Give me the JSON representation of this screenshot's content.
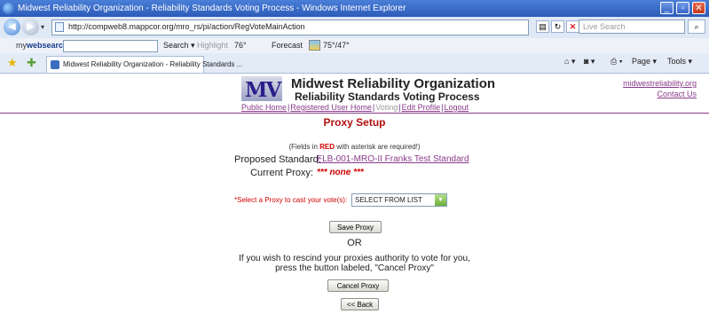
{
  "window": {
    "title": "Midwest Reliability Organization - Reliability Standards Voting Process - Windows Internet Explorer"
  },
  "addressbar": {
    "url": "http://compweb8.mappcor.org/mro_rs/pi/action/RegVoteMainAction",
    "search_placeholder": "Live Search"
  },
  "searchbar": {
    "brand_prefix": "my",
    "brand_name": "websearch",
    "search_label": "Search ▾",
    "highlight_label": "Highlight",
    "weather": "76°",
    "forecast_label": "Forecast",
    "forecast_temps": "75°/47°"
  },
  "tabbar": {
    "tab_title": "Midwest Reliability Organization - Reliability Standards ...",
    "page_menu": "Page ▾",
    "tools_menu": "Tools ▾"
  },
  "header": {
    "org_name": "Midwest Reliability Organization",
    "subtitle": "Reliability Standards Voting Process",
    "nav": {
      "public_home": "Public Home",
      "registered_user_home": "Registered User Home",
      "voting": "Voting",
      "edit_profile": "Edit Profile",
      "logout": "Logout"
    },
    "side_links": {
      "site": "midwestreliability.org",
      "contact": "Contact Us"
    }
  },
  "main": {
    "title": "Proxy Setup",
    "req_note_prefix": "(Fields in",
    "req_note_red": "RED",
    "req_note_suffix": "with asterisk are required!)",
    "proposed_standard_label": "Proposed Standard:",
    "proposed_standard_value": "FLB-001-MRO-II Franks Test Standard",
    "current_proxy_label": "Current Proxy:",
    "current_proxy_value": "*** none ***",
    "select_label": "*Select a Proxy to cast your vote(s):",
    "select_value": "SELECT FROM LIST",
    "save_button": "Save Proxy",
    "or_text": "OR",
    "rescind_line1": "If you wish to rescind your proxies authority to vote for you,",
    "rescind_line2": "press the button labeled, \"Cancel Proxy\"",
    "cancel_button": "Cancel Proxy",
    "back_button": "<< Back"
  }
}
